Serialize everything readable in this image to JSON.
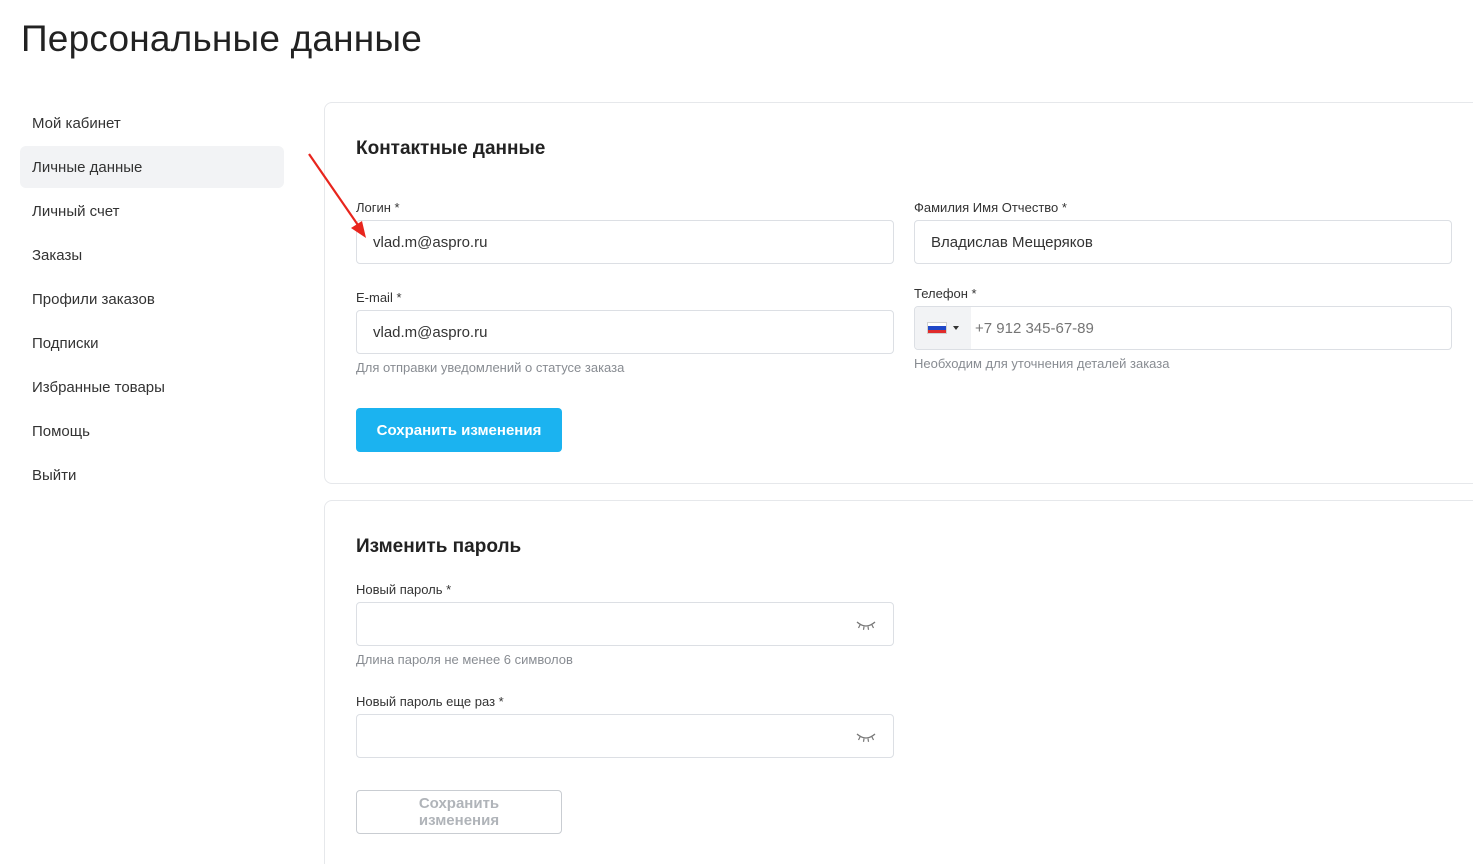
{
  "page": {
    "title": "Персональные данные"
  },
  "sidebar": {
    "items": [
      {
        "label": "Мой кабинет",
        "active": false
      },
      {
        "label": "Личные данные",
        "active": true
      },
      {
        "label": "Личный счет",
        "active": false
      },
      {
        "label": "Заказы",
        "active": false
      },
      {
        "label": "Профили заказов",
        "active": false
      },
      {
        "label": "Подписки",
        "active": false
      },
      {
        "label": "Избранные товары",
        "active": false
      },
      {
        "label": "Помощь",
        "active": false
      },
      {
        "label": "Выйти",
        "active": false
      }
    ]
  },
  "contacts": {
    "title": "Контактные данные",
    "login": {
      "label": "Логин *",
      "value": "vlad.m@aspro.ru"
    },
    "fullname": {
      "label": "Фамилия Имя Отчество *",
      "value": "Владислав Мещеряков"
    },
    "email": {
      "label": "E-mail *",
      "value": "vlad.m@aspro.ru",
      "hint": "Для отправки уведомлений о статусе заказа"
    },
    "phone": {
      "label": "Телефон *",
      "placeholder": "+7 912 345-67-89",
      "hint": "Необходим для уточнения деталей заказа",
      "flag_icon": "russia-flag-icon"
    },
    "save_label": "Сохранить изменения"
  },
  "password": {
    "title": "Изменить пароль",
    "new": {
      "label": "Новый пароль *",
      "hint": "Длина пароля не менее 6 символов",
      "icon": "eye-closed-icon"
    },
    "repeat": {
      "label": "Новый пароль еще раз *",
      "icon": "eye-closed-icon"
    },
    "save_label": "Сохранить изменения"
  },
  "colors": {
    "accent": "#1bb3f0",
    "active_bg": "#f2f3f5",
    "annotation_arrow": "#e8251d"
  }
}
